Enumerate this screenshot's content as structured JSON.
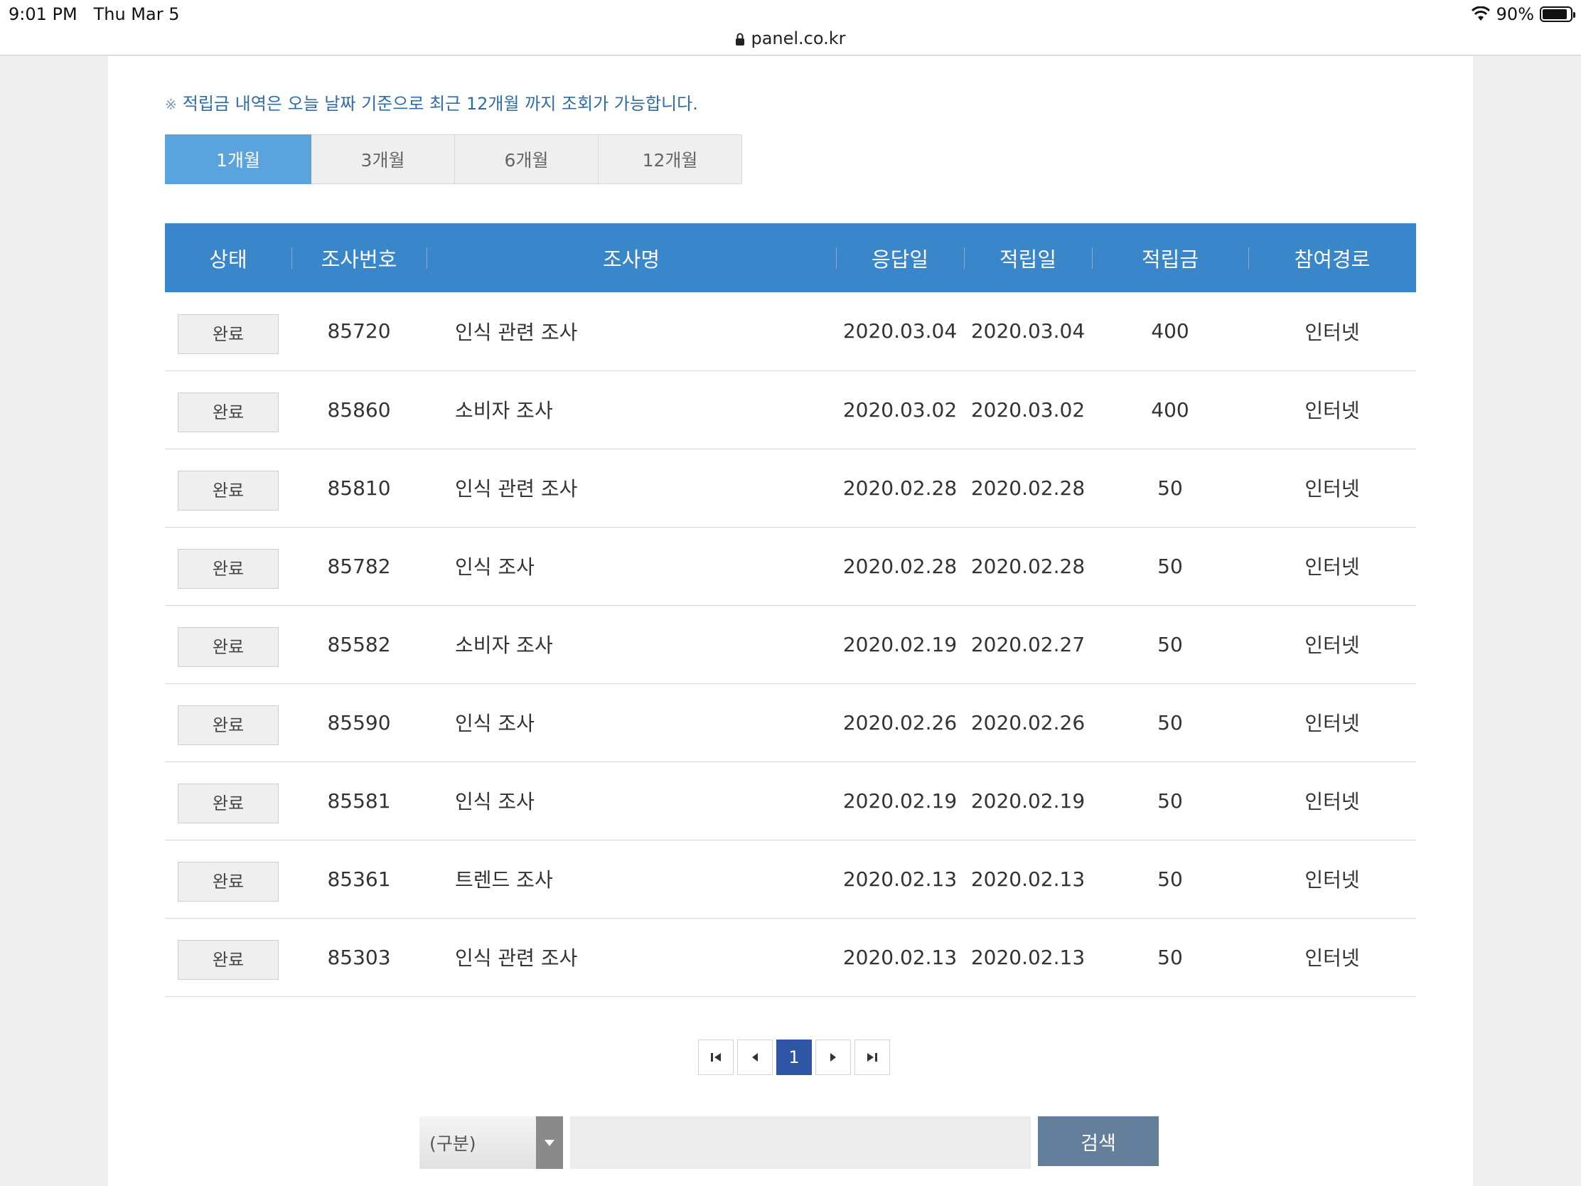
{
  "status_bar": {
    "time": "9:01 PM",
    "date": "Thu Mar 5",
    "battery": "90%"
  },
  "url_bar": {
    "host": "panel.co.kr"
  },
  "notice": {
    "mark": "※",
    "text": "적립금 내역은 오늘 날짜 기준으로 최근 12개월 까지 조회가 가능합니다."
  },
  "period_tabs": [
    "1개월",
    "3개월",
    "6개월",
    "12개월"
  ],
  "table": {
    "headers": [
      "상태",
      "조사번호",
      "조사명",
      "응답일",
      "적립일",
      "적립금",
      "참여경로"
    ],
    "rows": [
      {
        "status": "완료",
        "id": "85720",
        "name": "인식 관련 조사",
        "response_date": "2020.03.04",
        "reward_date": "2020.03.04",
        "amount": "400",
        "route": "인터넷"
      },
      {
        "status": "완료",
        "id": "85860",
        "name": "소비자 조사",
        "response_date": "2020.03.02",
        "reward_date": "2020.03.02",
        "amount": "400",
        "route": "인터넷"
      },
      {
        "status": "완료",
        "id": "85810",
        "name": "인식 관련 조사",
        "response_date": "2020.02.28",
        "reward_date": "2020.02.28",
        "amount": "50",
        "route": "인터넷"
      },
      {
        "status": "완료",
        "id": "85782",
        "name": "인식 조사",
        "response_date": "2020.02.28",
        "reward_date": "2020.02.28",
        "amount": "50",
        "route": "인터넷"
      },
      {
        "status": "완료",
        "id": "85582",
        "name": "소비자 조사",
        "response_date": "2020.02.19",
        "reward_date": "2020.02.27",
        "amount": "50",
        "route": "인터넷"
      },
      {
        "status": "완료",
        "id": "85590",
        "name": "인식 조사",
        "response_date": "2020.02.26",
        "reward_date": "2020.02.26",
        "amount": "50",
        "route": "인터넷"
      },
      {
        "status": "완료",
        "id": "85581",
        "name": "인식 조사",
        "response_date": "2020.02.19",
        "reward_date": "2020.02.19",
        "amount": "50",
        "route": "인터넷"
      },
      {
        "status": "완료",
        "id": "85361",
        "name": "트렌드 조사",
        "response_date": "2020.02.13",
        "reward_date": "2020.02.13",
        "amount": "50",
        "route": "인터넷"
      },
      {
        "status": "완료",
        "id": "85303",
        "name": "인식 관련 조사",
        "response_date": "2020.02.13",
        "reward_date": "2020.02.13",
        "amount": "50",
        "route": "인터넷"
      }
    ]
  },
  "pagination": {
    "current_page": "1"
  },
  "search": {
    "select_value": "(구분)",
    "input_value": "",
    "button_label": "검색"
  },
  "colors": {
    "header_blue": "#3a86cb",
    "active_tab": "#5aa3dc",
    "page_current": "#2e56a5",
    "search_button": "#647f9b"
  }
}
